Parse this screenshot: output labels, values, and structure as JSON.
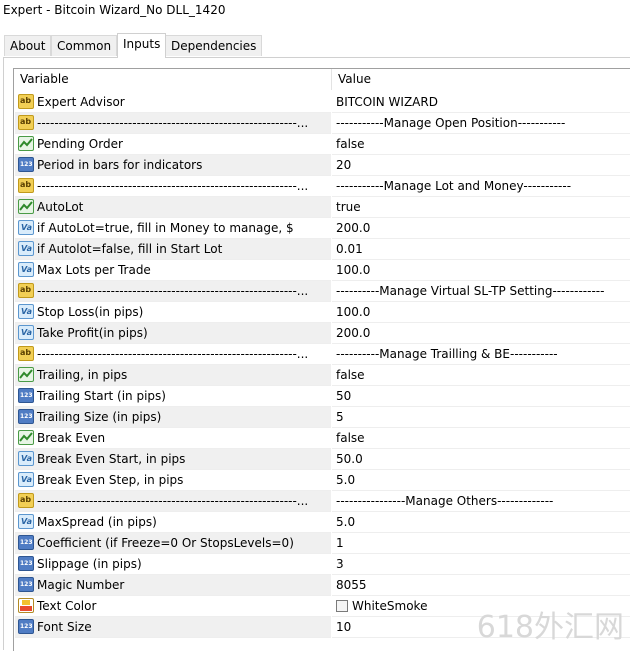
{
  "window": {
    "title": "Expert - Bitcoin Wizard_No DLL_1420"
  },
  "tabs": [
    "About",
    "Common",
    "Inputs",
    "Dependencies"
  ],
  "active_tab": "Inputs",
  "table": {
    "columns": {
      "variable": "Variable",
      "value": "Value"
    },
    "rows": [
      {
        "icon": "ab",
        "variable": "Expert Advisor",
        "value": "BITCOIN WIZARD"
      },
      {
        "icon": "ab",
        "variable": "------------------------------------------------------------...",
        "value": "-----------Manage Open Position-----------"
      },
      {
        "icon": "bool",
        "variable": "Pending Order",
        "value": "false"
      },
      {
        "icon": "num",
        "variable": "Period in bars for indicators",
        "value": "20"
      },
      {
        "icon": "ab",
        "variable": "------------------------------------------------------------...",
        "value": "-----------Manage Lot and Money-----------"
      },
      {
        "icon": "bool",
        "variable": "AutoLot",
        "value": "true"
      },
      {
        "icon": "dbl",
        "variable": "if AutoLot=true, fill in Money to manage, $",
        "value": "200.0"
      },
      {
        "icon": "dbl",
        "variable": "if Autolot=false, fill in Start Lot",
        "value": "0.01"
      },
      {
        "icon": "dbl",
        "variable": "Max Lots per Trade",
        "value": "100.0"
      },
      {
        "icon": "ab",
        "variable": "------------------------------------------------------------...",
        "value": "----------Manage Virtual SL-TP Setting------------"
      },
      {
        "icon": "dbl",
        "variable": "Stop Loss(in pips)",
        "value": "100.0"
      },
      {
        "icon": "dbl",
        "variable": "Take Profit(in pips)",
        "value": "200.0"
      },
      {
        "icon": "ab",
        "variable": "------------------------------------------------------------...",
        "value": "----------Manage Trailling & BE-----------"
      },
      {
        "icon": "bool",
        "variable": "Trailing, in pips",
        "value": "false"
      },
      {
        "icon": "num",
        "variable": "Trailing Start (in pips)",
        "value": "50"
      },
      {
        "icon": "num",
        "variable": "Trailing Size (in pips)",
        "value": "5"
      },
      {
        "icon": "bool",
        "variable": "Break Even",
        "value": "false"
      },
      {
        "icon": "dbl",
        "variable": "Break Even Start, in pips",
        "value": "50.0"
      },
      {
        "icon": "dbl",
        "variable": "Break Even Step, in pips",
        "value": "5.0"
      },
      {
        "icon": "ab",
        "variable": "------------------------------------------------------------...",
        "value": "----------------Manage Others-------------"
      },
      {
        "icon": "dbl",
        "variable": "MaxSpread (in pips)",
        "value": "5.0"
      },
      {
        "icon": "num",
        "variable": "Coefficient (if Freeze=0 Or StopsLevels=0)",
        "value": "1"
      },
      {
        "icon": "num",
        "variable": "Slippage (in pips)",
        "value": "3"
      },
      {
        "icon": "num",
        "variable": "Magic Number",
        "value": "8055"
      },
      {
        "icon": "color",
        "variable": "Text Color",
        "value": "WhiteSmoke",
        "swatch": "#f5f5f5"
      },
      {
        "icon": "num",
        "variable": "Font Size",
        "value": "10"
      }
    ]
  },
  "watermark": "618外汇网",
  "icon_names": {
    "ab": "string-type-icon",
    "bool": "bool-type-icon",
    "num": "integer-type-icon",
    "dbl": "double-type-icon",
    "color": "color-type-icon"
  }
}
